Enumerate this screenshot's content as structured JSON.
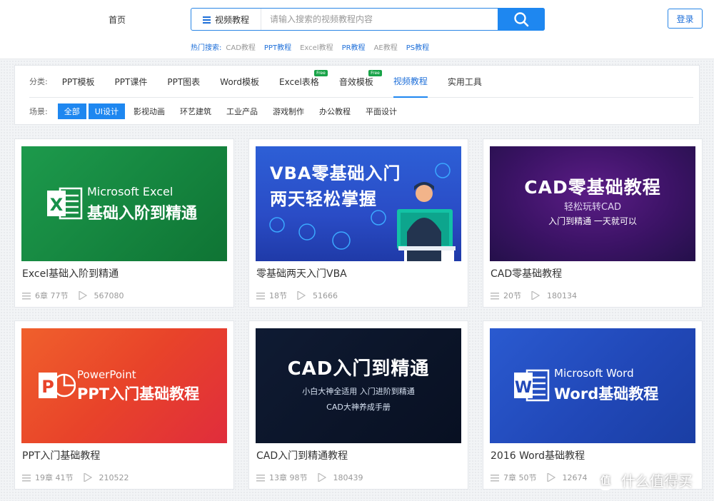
{
  "header": {
    "home": "首页",
    "search": {
      "type_label": "视频教程",
      "placeholder": "请输入搜索的视频教程内容"
    },
    "hot_label": "热门搜索:",
    "hot_items": [
      "CAD教程",
      "PPT教程",
      "Excel教程",
      "PR教程",
      "AE教程",
      "PS教程"
    ],
    "login": "登录"
  },
  "filters": {
    "category_label": "分类:",
    "categories": [
      "PPT模板",
      "PPT课件",
      "PPT图表",
      "Word模板",
      "Excel表格",
      "音效模板",
      "视频教程",
      "实用工具"
    ],
    "free_badge": "Free",
    "scene_label": "场景:",
    "scenes": [
      "全部",
      "UI设计",
      "影视动画",
      "环艺建筑",
      "工业产品",
      "游戏制作",
      "办公教程",
      "平面设计"
    ]
  },
  "cards": [
    {
      "title": "Excel基础入阶到精通",
      "lessons": "6章 77节",
      "plays": "567080",
      "thumb_line1": "Microsoft Excel",
      "thumb_line2": "基础入阶到精通"
    },
    {
      "title": "零基础两天入门VBA",
      "lessons": "18节",
      "plays": "51666",
      "thumb_line1": "VBA零基础入门",
      "thumb_line2": "两天轻松掌握"
    },
    {
      "title": "CAD零基础教程",
      "lessons": "20节",
      "plays": "180134",
      "thumb_line1": "CAD零基础教程",
      "thumb_line2": "轻松玩转CAD",
      "thumb_line3": "入门到精通 一天就可以"
    },
    {
      "title": "PPT入门基础教程",
      "lessons": "19章 41节",
      "plays": "210522",
      "thumb_line1": "PowerPoint",
      "thumb_line2": "PPT入门基础教程"
    },
    {
      "title": "CAD入门到精通教程",
      "lessons": "13章 98节",
      "plays": "180439",
      "thumb_line1": "CAD入门到精通",
      "thumb_line2": "小白大神全适用 入门进阶到精通",
      "thumb_line3": "CAD大神养成手册"
    },
    {
      "title": "2016 Word基础教程",
      "lessons": "7章 50节",
      "plays": "12674",
      "thumb_line1": "Microsoft Word",
      "thumb_line2": "Word基础教程"
    }
  ],
  "watermark": "什么值得买",
  "colors": {
    "accent": "#1e87f0",
    "free": "#18a348"
  }
}
